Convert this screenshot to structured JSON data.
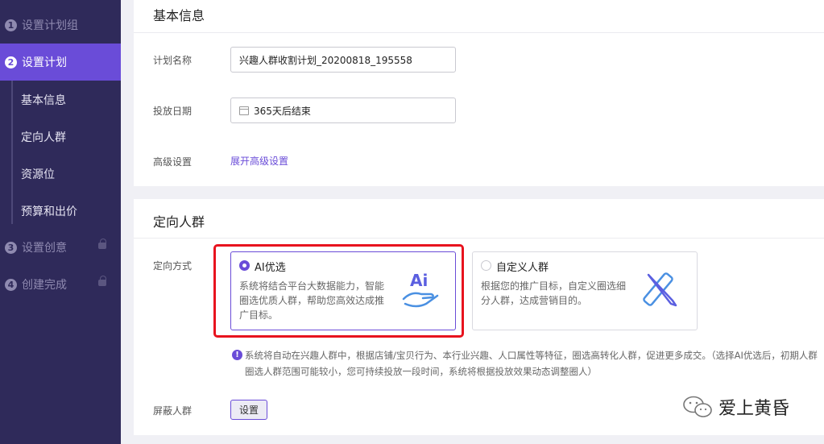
{
  "sidebar": {
    "steps": [
      {
        "num": "1",
        "label": "设置计划组"
      },
      {
        "num": "2",
        "label": "设置计划"
      },
      {
        "num": "3",
        "label": "设置创意"
      },
      {
        "num": "4",
        "label": "创建完成"
      }
    ],
    "sub_items": [
      "基本信息",
      "定向人群",
      "资源位",
      "预算和出价"
    ]
  },
  "basic_info": {
    "title": "基本信息",
    "plan_name_label": "计划名称",
    "plan_name_value": "兴趣人群收割计划_20200818_195558",
    "date_label": "投放日期",
    "date_value": "365天后结束",
    "advanced_label": "高级设置",
    "advanced_link": "展开高级设置"
  },
  "targeting": {
    "title": "定向人群",
    "method_label": "定向方式",
    "options": [
      {
        "title": "AI优选",
        "desc": "系统将结合平台大数据能力，智能圈选优质人群，帮助您高效达成推广目标。",
        "selected": true,
        "icon": "ai-hand-icon"
      },
      {
        "title": "自定义人群",
        "desc": "根据您的推广目标，自定义圈选细分人群，达成营销目的。",
        "selected": false,
        "icon": "pencil-ruler-icon"
      }
    ],
    "notice": "系统将自动在兴趣人群中，根据店铺/宝贝行为、本行业兴趣、人口属性等特征，圈选高转化人群，促进更多成交。（选择AI优选后，初期人群圈选人群范围可能较小，您可持续投放一段时间，系统将根据投放效果动态调整圈人）",
    "exclude_label": "屏蔽人群",
    "exclude_button": "设置"
  },
  "watermark": {
    "text": "爱上黄昏"
  },
  "colors": {
    "accent": "#6a4cd8",
    "sidebar_bg": "#2f2a5a",
    "highlight_frame": "#e8131e"
  }
}
